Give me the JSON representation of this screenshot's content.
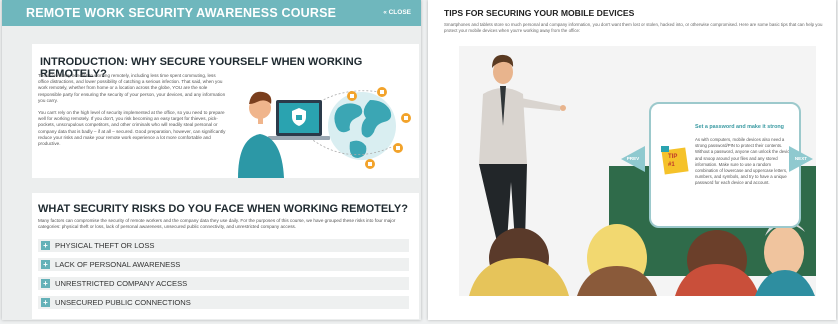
{
  "course": {
    "title": "REMOTE WORK SECURITY AWARENESS COURSE",
    "close_label": "« CLOSE"
  },
  "intro": {
    "heading": "INTRODUCTION: WHY SECURE YOURSELF WHEN WORKING REMOTELY?",
    "paragraph1": "There are many benefits to working remotely, including less time spent commuting, less office distractions, and lower possibility of catching a serious infection. That said, when you work remotely, whether from home or a location across the globe, YOU are the sole responsible party for ensuring the security of your person, your devices, and any information you carry.",
    "paragraph2": "You can't rely on the high level of security implemented at the office, so you need to prepare well for working remotely. If you don't, you risk becoming an easy target for thieves, pick-pockets, unscrupulous competitors, and other criminals who will readily steal personal or company data that is badly – if at all – secured. Good preparation, however, can significantly reduce your risks and make your remote work experience a lot more comfortable and productive."
  },
  "risks": {
    "heading": "WHAT SECURITY RISKS DO YOU FACE WHEN WORKING REMOTELY?",
    "paragraph": "Many factors can compromise the security of remote workers and the company data they use daily. For the purposes of this course, we have grouped these risks into four major categories: physical theft or loss, lack of personal awareness, unsecured public connectivity, and unrestricted company access.",
    "items": [
      {
        "label": "PHYSICAL THEFT OR LOSS"
      },
      {
        "label": "LACK OF PERSONAL AWARENESS"
      },
      {
        "label": "UNRESTRICTED COMPANY ACCESS"
      },
      {
        "label": "UNSECURED PUBLIC CONNECTIONS"
      }
    ]
  },
  "mobile": {
    "heading": "TIPS FOR SECURING YOUR MOBILE DEVICES",
    "paragraph": "Smartphones and tablets store so much personal and company information, you don't want them lost or stolen, hacked into, or otherwise compromised. Here are some basic tips that can help you protect your mobile devices when you're working away from the office:",
    "tip": {
      "badge_word": "TIP",
      "badge_num": "#1",
      "title": "Set a password and make it strong",
      "text": "As with computers, mobile devices also need a strong password/PIN to protect their contents. Without a password, anyone can unlock the device and snoop around your files and any stored information. Make sure to use a random combination of lowercase and uppercase letters, numbers, and symbols, and try to have a unique password for each device and account."
    },
    "prev_label": "PREV",
    "next_label": "NEXT"
  },
  "colors": {
    "accent": "#6fb7bd",
    "accent_dark": "#3a9aa2",
    "tip_badge": "#f5c22a",
    "board_green": "#2f6b4a"
  }
}
